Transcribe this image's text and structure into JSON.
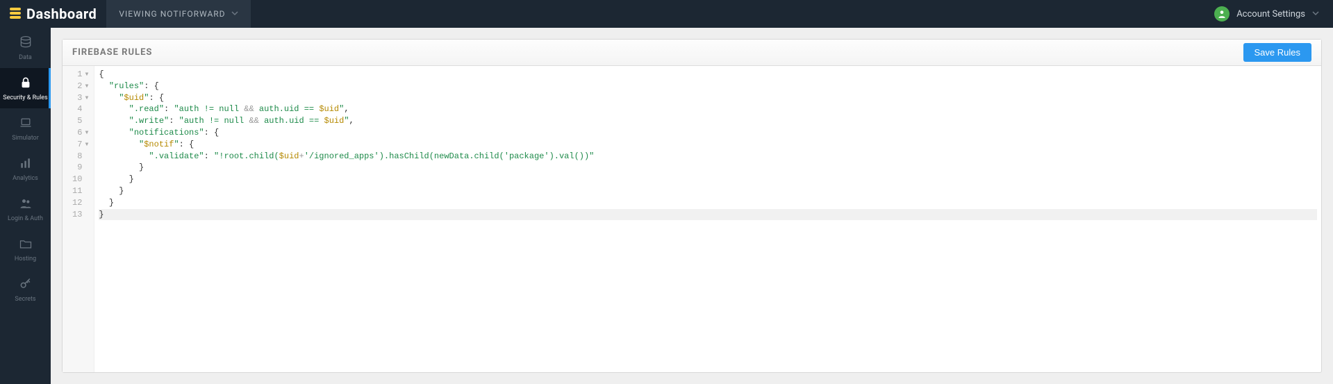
{
  "header": {
    "brand": "Dashboard",
    "project_prefix": "VIEWING",
    "project_name": "NOTIFORWARD",
    "account_label": "Account Settings"
  },
  "sidebar": {
    "items": [
      {
        "id": "data",
        "label": "Data"
      },
      {
        "id": "security",
        "label": "Security & Rules"
      },
      {
        "id": "simulator",
        "label": "Simulator"
      },
      {
        "id": "analytics",
        "label": "Analytics"
      },
      {
        "id": "login",
        "label": "Login & Auth"
      },
      {
        "id": "hosting",
        "label": "Hosting"
      },
      {
        "id": "secrets",
        "label": "Secrets"
      }
    ],
    "active_id": "security"
  },
  "panel": {
    "title": "FIREBASE RULES",
    "save_label": "Save Rules"
  },
  "editor": {
    "gutter": [
      {
        "num": "1",
        "fold": true
      },
      {
        "num": "2",
        "fold": true
      },
      {
        "num": "3",
        "fold": true
      },
      {
        "num": "4",
        "fold": false
      },
      {
        "num": "5",
        "fold": false
      },
      {
        "num": "6",
        "fold": true
      },
      {
        "num": "7",
        "fold": true
      },
      {
        "num": "8",
        "fold": false
      },
      {
        "num": "9",
        "fold": false
      },
      {
        "num": "10",
        "fold": false
      },
      {
        "num": "11",
        "fold": false
      },
      {
        "num": "12",
        "fold": false
      },
      {
        "num": "13",
        "fold": false
      }
    ],
    "current_line": 13,
    "lines": [
      [
        {
          "c": "punc",
          "t": "{"
        }
      ],
      [
        {
          "c": "plain",
          "t": "  "
        },
        {
          "c": "key",
          "t": "\"rules\""
        },
        {
          "c": "punc",
          "t": ": {"
        }
      ],
      [
        {
          "c": "plain",
          "t": "    "
        },
        {
          "c": "key",
          "t": "\""
        },
        {
          "c": "var",
          "t": "$uid"
        },
        {
          "c": "key",
          "t": "\""
        },
        {
          "c": "punc",
          "t": ": {"
        }
      ],
      [
        {
          "c": "plain",
          "t": "      "
        },
        {
          "c": "key",
          "t": "\".read\""
        },
        {
          "c": "punc",
          "t": ": "
        },
        {
          "c": "str",
          "t": "\"auth != null "
        },
        {
          "c": "op",
          "t": "&&"
        },
        {
          "c": "str",
          "t": " auth.uid == "
        },
        {
          "c": "var",
          "t": "$uid"
        },
        {
          "c": "str",
          "t": "\""
        },
        {
          "c": "punc",
          "t": ","
        }
      ],
      [
        {
          "c": "plain",
          "t": "      "
        },
        {
          "c": "key",
          "t": "\".write\""
        },
        {
          "c": "punc",
          "t": ": "
        },
        {
          "c": "str",
          "t": "\"auth != null "
        },
        {
          "c": "op",
          "t": "&&"
        },
        {
          "c": "str",
          "t": " auth.uid == "
        },
        {
          "c": "var",
          "t": "$uid"
        },
        {
          "c": "str",
          "t": "\""
        },
        {
          "c": "punc",
          "t": ","
        }
      ],
      [
        {
          "c": "plain",
          "t": "      "
        },
        {
          "c": "key",
          "t": "\"notifications\""
        },
        {
          "c": "punc",
          "t": ": {"
        }
      ],
      [
        {
          "c": "plain",
          "t": "        "
        },
        {
          "c": "key",
          "t": "\""
        },
        {
          "c": "var",
          "t": "$notif"
        },
        {
          "c": "key",
          "t": "\""
        },
        {
          "c": "punc",
          "t": ": {"
        }
      ],
      [
        {
          "c": "plain",
          "t": "          "
        },
        {
          "c": "key",
          "t": "\".validate\""
        },
        {
          "c": "punc",
          "t": ": "
        },
        {
          "c": "str",
          "t": "\"!root.child("
        },
        {
          "c": "var",
          "t": "$uid"
        },
        {
          "c": "op",
          "t": "+"
        },
        {
          "c": "lit",
          "t": "'/ignored_apps'"
        },
        {
          "c": "str",
          "t": ").hasChild(newData.child("
        },
        {
          "c": "lit",
          "t": "'package'"
        },
        {
          "c": "str",
          "t": ").val())\""
        }
      ],
      [
        {
          "c": "plain",
          "t": "        "
        },
        {
          "c": "punc",
          "t": "}"
        }
      ],
      [
        {
          "c": "plain",
          "t": "      "
        },
        {
          "c": "punc",
          "t": "}"
        }
      ],
      [
        {
          "c": "plain",
          "t": "    "
        },
        {
          "c": "punc",
          "t": "}"
        }
      ],
      [
        {
          "c": "plain",
          "t": "  "
        },
        {
          "c": "punc",
          "t": "}"
        }
      ],
      [
        {
          "c": "punc",
          "t": "}"
        }
      ]
    ]
  },
  "colors": {
    "accent": "#2b98f0",
    "brand_yellow": "#f9ca3f"
  }
}
